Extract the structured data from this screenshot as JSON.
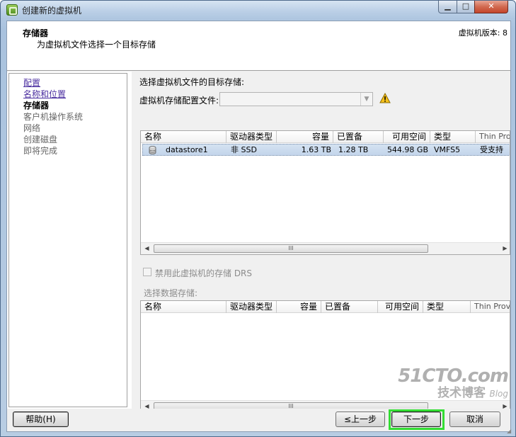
{
  "window": {
    "title": "创建新的虚拟机",
    "minimize": "▁",
    "maximize": "□",
    "close": "✕"
  },
  "header": {
    "title": "存储器",
    "subtitle": "为虚拟机文件选择一个目标存储",
    "version": "虚拟机版本: 8"
  },
  "nav": {
    "items": [
      {
        "label": "配置",
        "state": "link"
      },
      {
        "label": "名称和位置",
        "state": "link"
      },
      {
        "label": "存储器",
        "state": "current"
      },
      {
        "label": "客户机操作系统",
        "state": "pending"
      },
      {
        "label": "网络",
        "state": "pending"
      },
      {
        "label": "创建磁盘",
        "state": "pending"
      },
      {
        "label": "即将完成",
        "state": "pending"
      }
    ]
  },
  "storage": {
    "select_label": "选择虚拟机文件的目标存储:",
    "profile_label": "虚拟机存储配置文件:",
    "profile_value": "",
    "warning_icon": "warning-triangle-icon",
    "columns": [
      "名称",
      "驱动器类型",
      "容量",
      "已置备",
      "可用空间",
      "类型",
      "Thin Provi"
    ],
    "rows": [
      {
        "name": "datastore1",
        "drive_type": "非 SSD",
        "capacity": "1.63 TB",
        "provisioned": "1.28 TB",
        "free": "544.98 GB",
        "type": "VMFS5",
        "thin": "受支持",
        "icon": "datastore-icon"
      }
    ],
    "scroll_grip": "III",
    "disable_drs_label": "禁用此虚拟机的存储 DRS",
    "disable_drs_checked": false,
    "select_datastore_label": "选择数据存储:",
    "columns2": [
      "名称",
      "驱动器类型",
      "容量",
      "已置备",
      "可用空间",
      "类型",
      "Thin Provi"
    ]
  },
  "footer": {
    "help": "帮助(H)",
    "back": "≤上一步",
    "next": "下一步",
    "cancel": "取消"
  },
  "watermark": {
    "line1": "51CTO.com",
    "line2": "技术博客",
    "line2b": "Blog"
  },
  "colors": {
    "accent_highlight": "#33dd33",
    "selected_row": "#c3d5eb",
    "nav_link": "#4b2fa0"
  }
}
